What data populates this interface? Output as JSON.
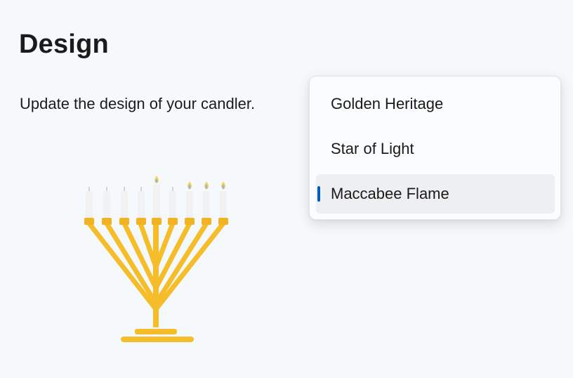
{
  "page": {
    "title": "Design",
    "description": "Update the design of your candler."
  },
  "design_dropdown": {
    "options": [
      {
        "label": "Golden Heritage",
        "selected": false
      },
      {
        "label": "Star of Light",
        "selected": false
      },
      {
        "label": "Maccabee Flame",
        "selected": true
      }
    ],
    "accent_color": "#005fb8"
  },
  "menorah": {
    "metal_color": "#f5bd2a",
    "candle_color": "#f2f2f2",
    "flame_color": "#f7d36b",
    "candle_count": 9,
    "lit_candles": [
      5,
      7,
      8,
      9
    ]
  }
}
